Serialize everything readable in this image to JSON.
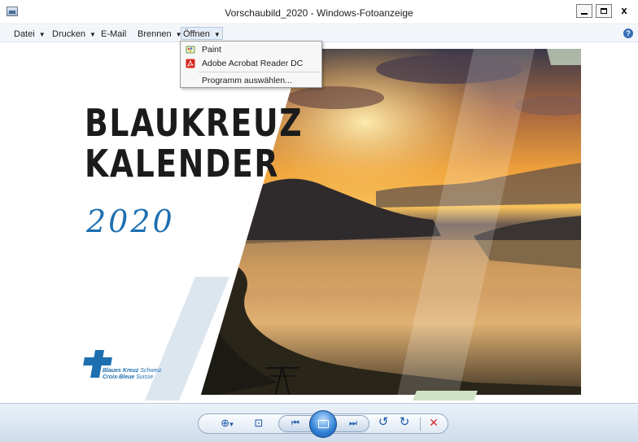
{
  "window": {
    "title": "Vorschaubild_2020 - Windows-Fotoanzeige",
    "buttons": {
      "minimize": "_",
      "maximize": "□",
      "close": "x"
    }
  },
  "menubar": {
    "items": [
      {
        "label": "Datei",
        "has_arrow": true
      },
      {
        "label": "Drucken",
        "has_arrow": true
      },
      {
        "label": "E-Mail",
        "has_arrow": false
      },
      {
        "label": "Brennen",
        "has_arrow": true
      },
      {
        "label": "Öffnen",
        "has_arrow": true
      }
    ],
    "arrow_glyph": "▼",
    "help_glyph": "?"
  },
  "open_menu": {
    "items": [
      {
        "label": "Paint",
        "icon": "paint-icon"
      },
      {
        "label": "Adobe Acrobat Reader DC",
        "icon": "acrobat-icon"
      },
      {
        "label": "Programm auswählen...",
        "icon": ""
      }
    ]
  },
  "poster": {
    "title_line1": "BLAUKREUZ",
    "title_line2": "KALENDER",
    "year": "2020",
    "logo_line1_bold": "Blaues Kreuz",
    "logo_line1_rest": "Schweiz",
    "logo_line2_bold": "Croix-Bleue",
    "logo_line2_rest": "Suisse",
    "brand_color": "#1d6fb0"
  },
  "toolbar": {
    "zoom_glyph": "⊕",
    "zoom_arrow": "▾",
    "actual_size_glyph": "⊡",
    "prev_glyph": "⏮",
    "next_glyph": "⏭",
    "rotate_ccw_glyph": "↺",
    "rotate_cw_glyph": "↻",
    "delete_glyph": "✕"
  }
}
